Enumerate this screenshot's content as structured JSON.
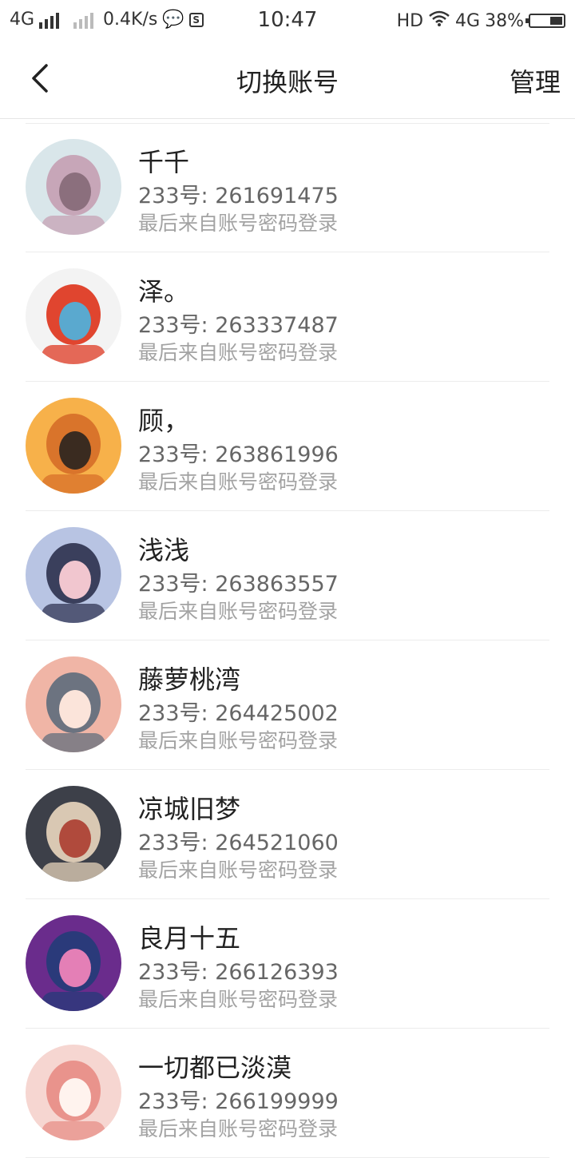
{
  "status_bar": {
    "network_left": "4G",
    "speed": "0.4K/s",
    "time": "10:47",
    "hd": "HD",
    "network_right": "4G",
    "battery": "38%"
  },
  "nav": {
    "title": "切换账号",
    "manage_label": "管理",
    "back_icon": "chevron-left-icon"
  },
  "accounts": [
    {
      "name": "千千",
      "uid": "233号: 261691475",
      "login": "最后来自账号密码登录",
      "colors": [
        "#d9e6ea",
        "#c7a6b8",
        "#8b6f7d"
      ]
    },
    {
      "name": "泽。",
      "uid": "233号: 263337487",
      "login": "最后来自账号密码登录",
      "colors": [
        "#f3f3f3",
        "#e0452f",
        "#5aa9cf"
      ]
    },
    {
      "name": "顾，",
      "uid": "233号: 263861996",
      "login": "最后来自账号密码登录",
      "colors": [
        "#f7b14a",
        "#d9742b",
        "#3a2b20"
      ]
    },
    {
      "name": "浅浅",
      "uid": "233号: 263863557",
      "login": "最后来自账号密码登录",
      "colors": [
        "#b8c4e3",
        "#3a3f5c",
        "#f1c6cf"
      ]
    },
    {
      "name": "藤萝桃湾",
      "uid": "233号: 264425002",
      "login": "最后来自账号密码登录",
      "colors": [
        "#f0b5a6",
        "#6c7380",
        "#fbe4da"
      ]
    },
    {
      "name": "凉城旧梦",
      "uid": "233号: 264521060",
      "login": "最后来自账号密码登录",
      "colors": [
        "#3d4049",
        "#d9c8b3",
        "#b04a3c"
      ]
    },
    {
      "name": "良月十五",
      "uid": "233号: 266126393",
      "login": "最后来自账号密码登录",
      "colors": [
        "#6a2c8c",
        "#2a3a7a",
        "#e47fb6"
      ]
    },
    {
      "name": "一切都已淡漠",
      "uid": "233号: 266199999",
      "login": "最后来自账号密码登录",
      "colors": [
        "#f6d6d1",
        "#e9938c",
        "#fff3ee"
      ]
    }
  ]
}
